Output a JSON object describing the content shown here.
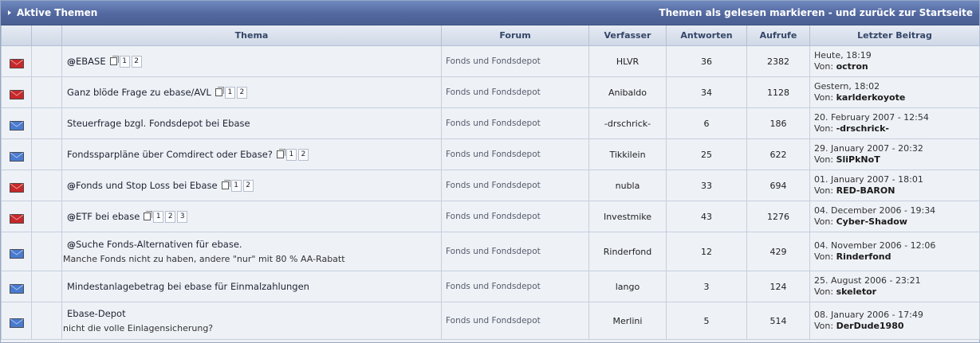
{
  "header": {
    "title": "Aktive Themen",
    "mark_read": "Themen als gelesen markieren - und zurück zur Startseite"
  },
  "columns": {
    "topic": "Thema",
    "forum": "Forum",
    "author": "Verfasser",
    "replies": "Antworten",
    "views": "Aufrufe",
    "last": "Letzter Beitrag"
  },
  "colors": {
    "hot": "#c8282a",
    "normal": "#4a7bd0"
  },
  "rows": [
    {
      "icon": "hot-envelope-icon",
      "prefix": "@",
      "title": "EBASE",
      "pages": [
        "1",
        "2"
      ],
      "desc": "",
      "forum": "Fonds und Fondsdepot",
      "author": "HLVR",
      "replies": "36",
      "views": "2382",
      "last_date": "Heute, 18:19",
      "last_by": "Von:",
      "last_user": "octron"
    },
    {
      "icon": "hot-envelope-icon",
      "prefix": "",
      "title": "Ganz blöde Frage zu ebase/AVL",
      "pages": [
        "1",
        "2"
      ],
      "desc": "",
      "forum": "Fonds und Fondsdepot",
      "author": "Anibaldo",
      "replies": "34",
      "views": "1128",
      "last_date": "Gestern, 18:02",
      "last_by": "Von:",
      "last_user": "karlderkoyote"
    },
    {
      "icon": "envelope-icon",
      "prefix": "",
      "title": "Steuerfrage bzgl. Fondsdepot bei Ebase",
      "pages": [],
      "desc": "",
      "forum": "Fonds und Fondsdepot",
      "author": "-drschrick-",
      "replies": "6",
      "views": "186",
      "last_date": "20. February 2007 - 12:54",
      "last_by": "Von:",
      "last_user": "-drschrick-"
    },
    {
      "icon": "envelope-icon",
      "prefix": "",
      "title": "Fondssparpläne über Comdirect oder Ebase?",
      "pages": [
        "1",
        "2"
      ],
      "desc": "",
      "forum": "Fonds und Fondsdepot",
      "author": "Tikkilein",
      "replies": "25",
      "views": "622",
      "last_date": "29. January 2007 - 20:32",
      "last_by": "Von:",
      "last_user": "SliPkNoT"
    },
    {
      "icon": "hot-envelope-icon",
      "prefix": "@",
      "title": "Fonds und Stop Loss bei Ebase",
      "pages": [
        "1",
        "2"
      ],
      "desc": "",
      "forum": "Fonds und Fondsdepot",
      "author": "nubla",
      "replies": "33",
      "views": "694",
      "last_date": "01. January 2007 - 18:01",
      "last_by": "Von:",
      "last_user": "RED-BARON"
    },
    {
      "icon": "hot-envelope-icon",
      "prefix": "@",
      "title": "ETF bei ebase",
      "pages": [
        "1",
        "2",
        "3"
      ],
      "desc": "",
      "forum": "Fonds und Fondsdepot",
      "author": "Investmike",
      "replies": "43",
      "views": "1276",
      "last_date": "04. December 2006 - 19:34",
      "last_by": "Von:",
      "last_user": "Cyber-Shadow"
    },
    {
      "icon": "envelope-icon",
      "prefix": "@",
      "title": "Suche Fonds-Alternativen für ebase.",
      "pages": [],
      "desc": "Manche Fonds nicht zu haben, andere \"nur\" mit 80 % AA-Rabatt",
      "forum": "Fonds und Fondsdepot",
      "author": "Rinderfond",
      "replies": "12",
      "views": "429",
      "last_date": "04. November 2006 - 12:06",
      "last_by": "Von:",
      "last_user": "Rinderfond"
    },
    {
      "icon": "envelope-icon",
      "prefix": "",
      "title": "Mindestanlagebetrag bei ebase für Einmalzahlungen",
      "pages": [],
      "desc": "",
      "forum": "Fonds und Fondsdepot",
      "author": "lango",
      "replies": "3",
      "views": "124",
      "last_date": "25. August 2006 - 23:21",
      "last_by": "Von:",
      "last_user": "skeletor"
    },
    {
      "icon": "envelope-icon",
      "prefix": "",
      "title": "Ebase-Depot",
      "pages": [],
      "desc": "nicht die volle Einlagensicherung?",
      "forum": "Fonds und Fondsdepot",
      "author": "Merlini",
      "replies": "5",
      "views": "514",
      "last_date": "08. January 2006 - 17:49",
      "last_by": "Von:",
      "last_user": "DerDude1980"
    }
  ]
}
